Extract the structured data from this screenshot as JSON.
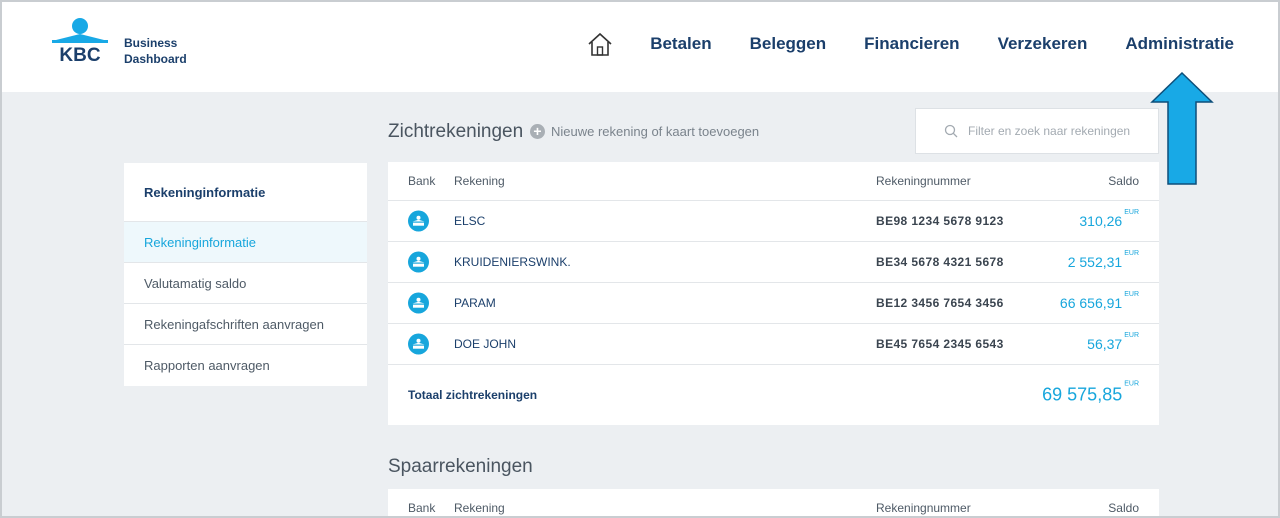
{
  "brand": {
    "line1": "Business",
    "line2": "Dashboard",
    "logo_text": "KBC"
  },
  "nav": {
    "home_icon": "home-icon",
    "items": [
      "Betalen",
      "Beleggen",
      "Financieren",
      "Verzekeren",
      "Administratie"
    ]
  },
  "sidebar": {
    "title": "Rekeninginformatie",
    "items": [
      {
        "label": "Rekeninginformatie",
        "active": true
      },
      {
        "label": "Valutamatig saldo",
        "active": false
      },
      {
        "label": "Rekeningafschriften aanvragen",
        "active": false
      },
      {
        "label": "Rapporten aanvragen",
        "active": false
      }
    ]
  },
  "current": {
    "title": "Zichtrekeningen",
    "add_label": "Nieuwe rekening of kaart toevoegen",
    "search_placeholder": "Filter en zoek naar rekeningen",
    "columns": {
      "bank": "Bank",
      "account": "Rekening",
      "number": "Rekeningnummer",
      "balance": "Saldo"
    },
    "rows": [
      {
        "name": "ELSC",
        "number": "BE98 1234 5678 9123",
        "balance": "310,26",
        "currency": "EUR"
      },
      {
        "name": "KRUIDENIERSWINK.",
        "number": "BE34 5678 4321 5678",
        "balance": "2 552,31",
        "currency": "EUR"
      },
      {
        "name": "PARAM",
        "number": "BE12 3456 7654 3456",
        "balance": "66 656,91",
        "currency": "EUR"
      },
      {
        "name": "DOE JOHN",
        "number": "BE45 7654 2345 6543",
        "balance": "56,37",
        "currency": "EUR"
      }
    ],
    "total_label": "Totaal zichtrekeningen",
    "total_balance": "69 575,85",
    "total_currency": "EUR"
  },
  "savings": {
    "title": "Spaarrekeningen",
    "columns": {
      "bank": "Bank",
      "account": "Rekening",
      "number": "Rekeningnummer",
      "balance": "Saldo"
    }
  },
  "colors": {
    "accent": "#17a6dc",
    "navy": "#1b3f6b",
    "arrow": "#18a9e6"
  }
}
